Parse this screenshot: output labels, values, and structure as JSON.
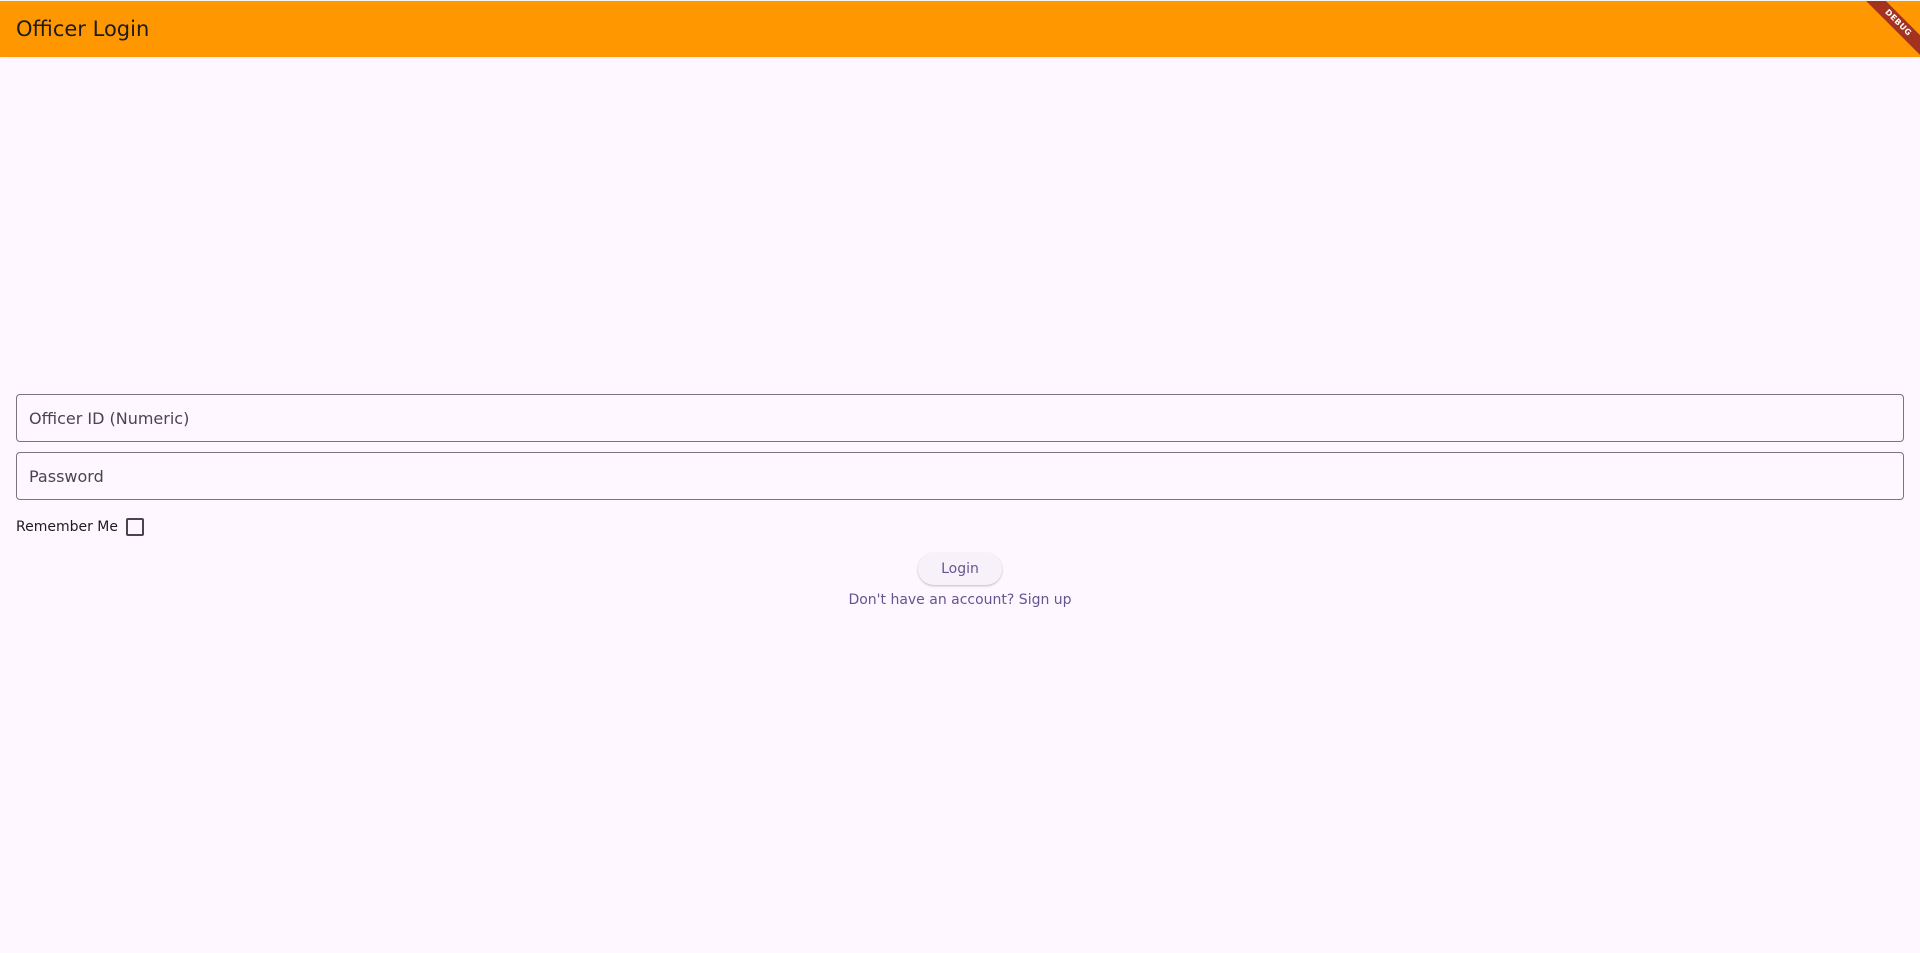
{
  "app_bar": {
    "title": "Officer Login",
    "background_color": "#FF9800",
    "debug_label": "DEBUG"
  },
  "form": {
    "officer_id": {
      "placeholder": "Officer ID (Numeric)",
      "value": ""
    },
    "password": {
      "placeholder": "Password",
      "value": ""
    },
    "remember_me": {
      "label": "Remember Me",
      "checked": false
    },
    "login_button_label": "Login",
    "signup_link_text": "Don't have an account? Sign up"
  },
  "colors": {
    "page_background": "#FEF7FF",
    "accent": "#65558F",
    "outline": "#79747E"
  }
}
